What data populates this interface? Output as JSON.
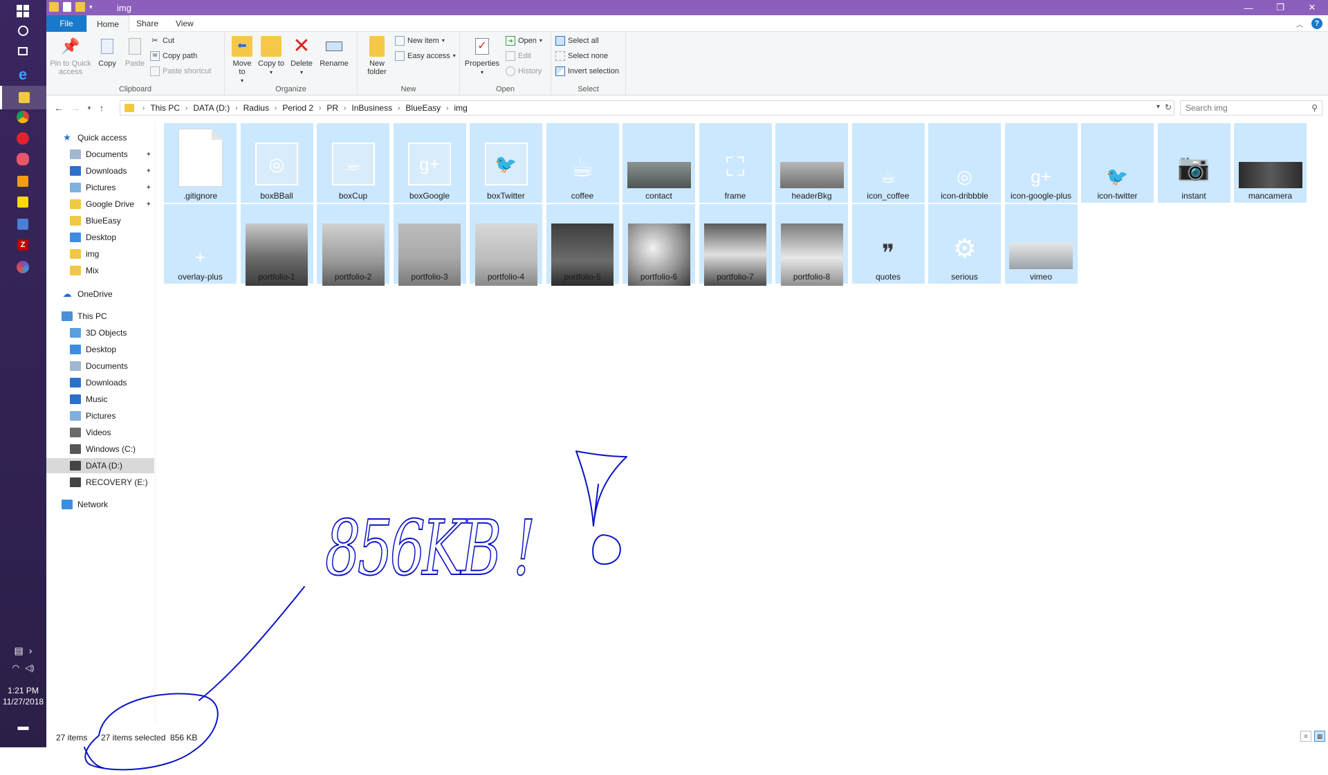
{
  "window": {
    "title": "img"
  },
  "ribbon": {
    "tabs": [
      "File",
      "Home",
      "Share",
      "View"
    ],
    "clipboard": {
      "label": "Clipboard",
      "pin": "Pin to Quick access",
      "copy": "Copy",
      "paste": "Paste",
      "cut": "Cut",
      "copy_path": "Copy path",
      "paste_shortcut": "Paste shortcut"
    },
    "organize": {
      "label": "Organize",
      "move_to": "Move to",
      "copy_to": "Copy to",
      "delete": "Delete",
      "rename": "Rename"
    },
    "new": {
      "label": "New",
      "new_folder": "New folder",
      "new_item": "New item",
      "easy_access": "Easy access"
    },
    "open": {
      "label": "Open",
      "properties": "Properties",
      "open": "Open",
      "edit": "Edit",
      "history": "History"
    },
    "select": {
      "label": "Select",
      "select_all": "Select all",
      "select_none": "Select none",
      "invert": "Invert selection"
    }
  },
  "address": {
    "breadcrumb": [
      "This PC",
      "DATA (D:)",
      "Radius",
      "Period 2",
      "PR",
      "InBusiness",
      "BlueEasy",
      "img"
    ],
    "search_placeholder": "Search img"
  },
  "nav": {
    "quick_access": "Quick access",
    "quick_items": [
      {
        "label": "Documents",
        "pinned": true
      },
      {
        "label": "Downloads",
        "pinned": true
      },
      {
        "label": "Pictures",
        "pinned": true
      },
      {
        "label": "Google Drive",
        "pinned": true
      },
      {
        "label": "BlueEasy",
        "pinned": false
      },
      {
        "label": "Desktop",
        "pinned": false
      },
      {
        "label": "img",
        "pinned": false
      },
      {
        "label": "Mix",
        "pinned": false
      }
    ],
    "onedrive": "OneDrive",
    "this_pc": "This PC",
    "pc_items": [
      "3D Objects",
      "Desktop",
      "Documents",
      "Downloads",
      "Music",
      "Pictures",
      "Videos",
      "Windows (C:)",
      "DATA (D:)",
      "RECOVERY (E:)"
    ],
    "network": "Network"
  },
  "files": [
    {
      "name": ".gitignore",
      "kind": "file"
    },
    {
      "name": "boxBBall",
      "kind": "box",
      "glyph": "dribbble-icon"
    },
    {
      "name": "boxCup",
      "kind": "box",
      "glyph": "cup-icon"
    },
    {
      "name": "boxGoogle",
      "kind": "box",
      "glyph": "google-plus-icon"
    },
    {
      "name": "boxTwitter",
      "kind": "box",
      "glyph": "twitter-icon"
    },
    {
      "name": "coffee",
      "kind": "icon",
      "glyph": "coffee-icon"
    },
    {
      "name": "contact",
      "kind": "wide"
    },
    {
      "name": "frame",
      "kind": "icon",
      "glyph": "frame-icon"
    },
    {
      "name": "headerBkg",
      "kind": "wide"
    },
    {
      "name": "icon_coffee",
      "kind": "icon",
      "glyph": "cup-icon"
    },
    {
      "name": "icon-dribbble",
      "kind": "icon",
      "glyph": "dribbble-icon"
    },
    {
      "name": "icon-google-plus",
      "kind": "icon",
      "glyph": "google-plus-icon"
    },
    {
      "name": "icon-twitter",
      "kind": "icon",
      "glyph": "twitter-icon"
    },
    {
      "name": "instant",
      "kind": "icon",
      "glyph": "camera-icon"
    },
    {
      "name": "mancamera",
      "kind": "wide"
    },
    {
      "name": "overlay-plus",
      "kind": "icon",
      "glyph": "plus-icon"
    },
    {
      "name": "portfolio-1",
      "kind": "photo"
    },
    {
      "name": "portfolio-2",
      "kind": "photo"
    },
    {
      "name": "portfolio-3",
      "kind": "photo"
    },
    {
      "name": "portfolio-4",
      "kind": "photo"
    },
    {
      "name": "portfolio-5",
      "kind": "photo"
    },
    {
      "name": "portfolio-6",
      "kind": "photo"
    },
    {
      "name": "portfolio-7",
      "kind": "photo"
    },
    {
      "name": "portfolio-8",
      "kind": "photo"
    },
    {
      "name": "quotes",
      "kind": "icon",
      "glyph": "quotes-icon"
    },
    {
      "name": "serious",
      "kind": "icon",
      "glyph": "robot-icon"
    },
    {
      "name": "vimeo",
      "kind": "wide"
    }
  ],
  "status": {
    "items": "27 items",
    "selected": "27 items selected  856 KB"
  },
  "taskbar": {
    "time": "1:21 PM",
    "date": "11/27/2018"
  },
  "annotation": {
    "handwritten_text": "856KB !"
  },
  "colors": {
    "title_bar": "#8c5fbd",
    "selection": "#cce8ff",
    "file_tab": "#1979ca",
    "ink": "#0a12c8"
  }
}
